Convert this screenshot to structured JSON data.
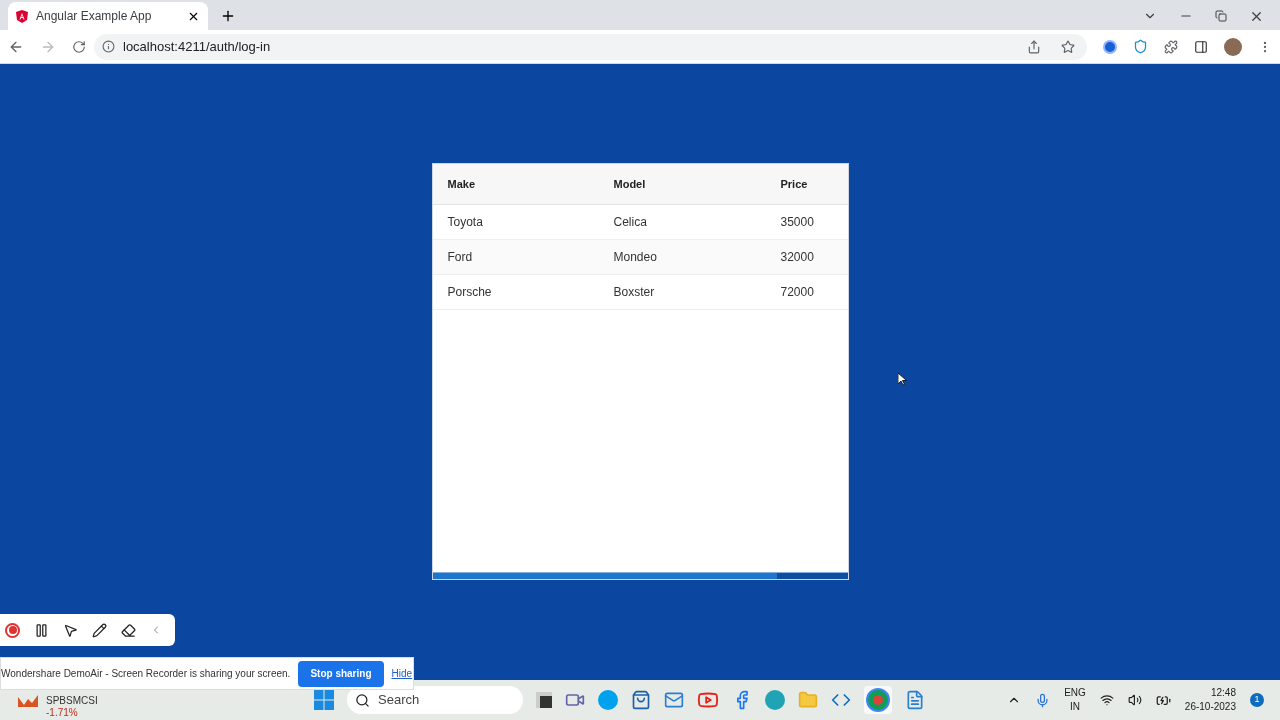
{
  "browser": {
    "tab_title": "Angular Example App",
    "url": "localhost:4211/auth/log-in"
  },
  "table": {
    "columns": [
      "Make",
      "Model",
      "Price"
    ],
    "rows": [
      [
        "Toyota",
        "Celica",
        "35000"
      ],
      [
        "Ford",
        "Mondeo",
        "32000"
      ],
      [
        "Porsche",
        "Boxster",
        "72000"
      ]
    ],
    "progress": {
      "level": 0.83
    }
  },
  "recorder_bar": {
    "message": "Wondershare DemoAir - Screen Recorder is sharing your screen.",
    "stop_button": "Stop sharing",
    "hide_link": "Hide"
  },
  "taskbar": {
    "stock": {
      "name": "SPBSMCSI",
      "change": "-1.71%"
    },
    "search": "Search",
    "language": "ENG",
    "region": "IN",
    "time": "12:48",
    "date": "26-10-2023",
    "notifications": "1"
  }
}
